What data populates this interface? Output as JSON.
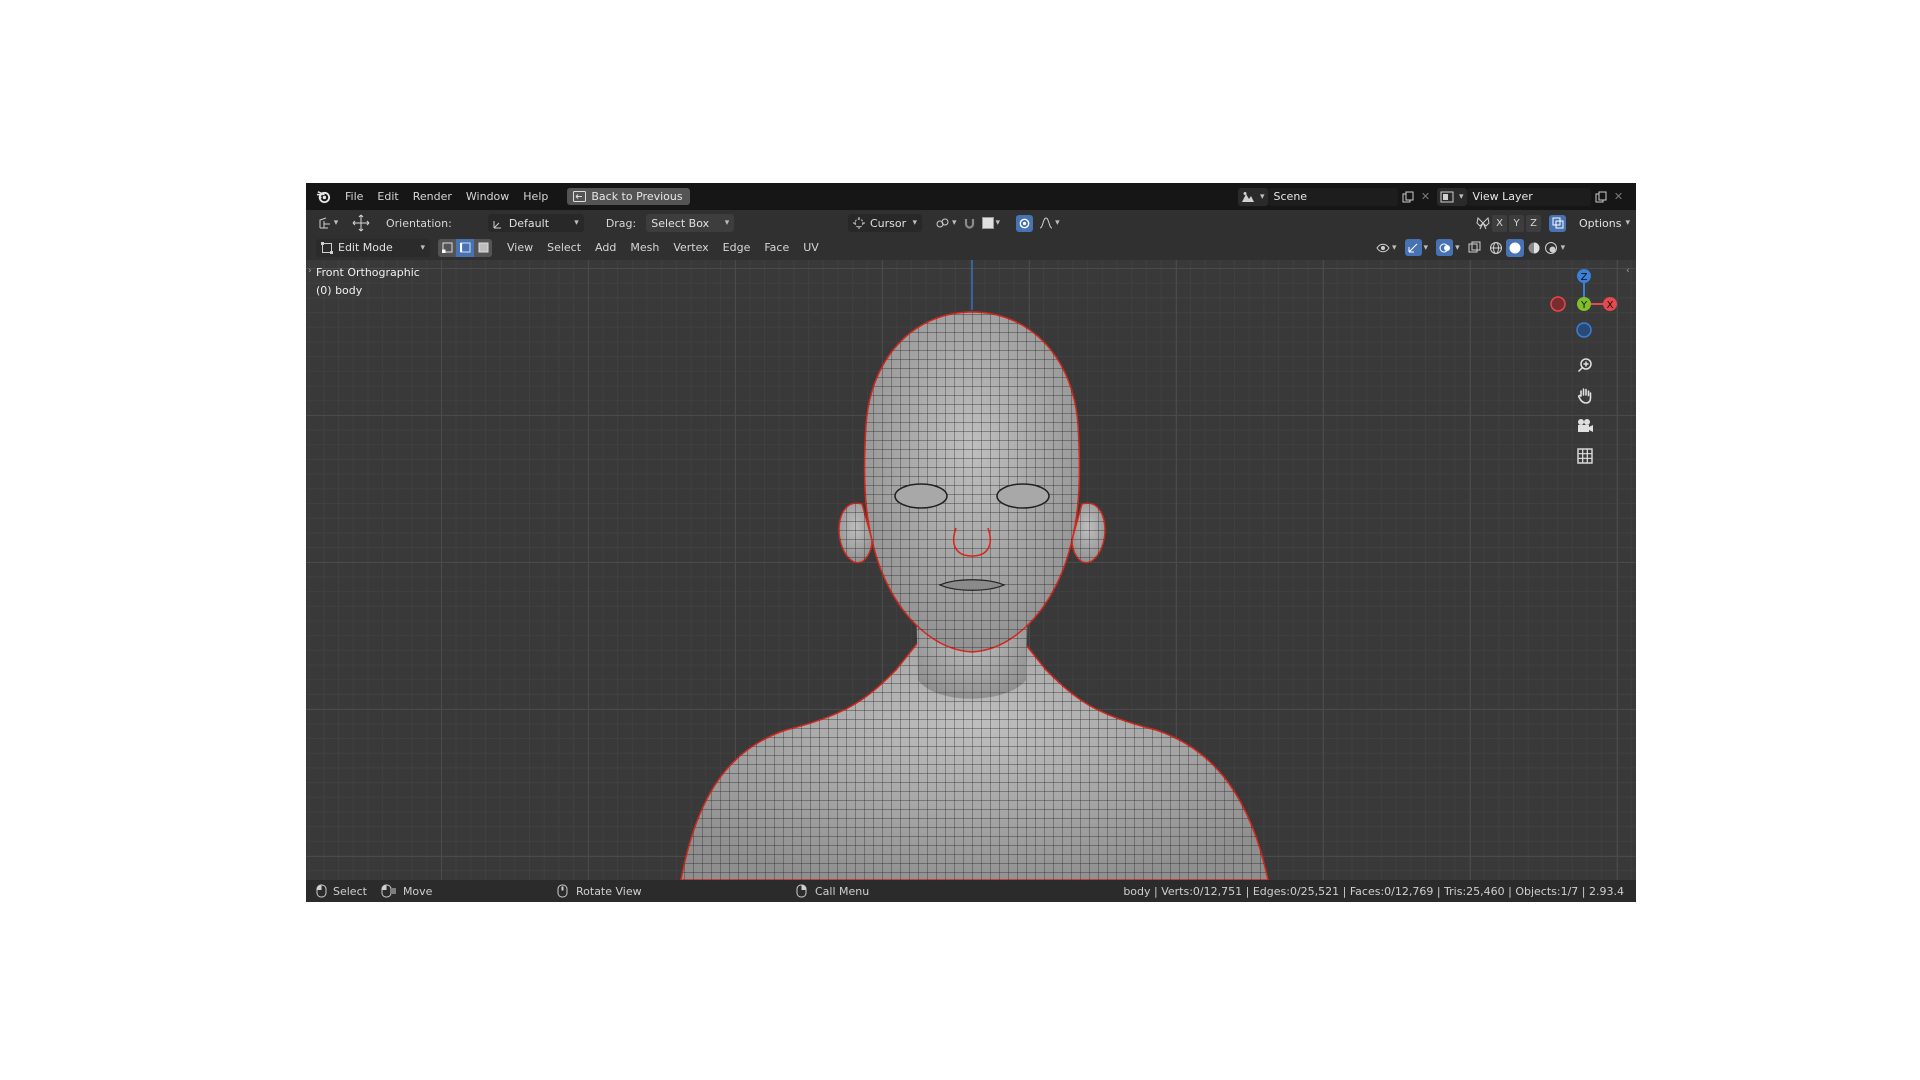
{
  "topbar": {
    "menus": [
      "File",
      "Edit",
      "Render",
      "Window",
      "Help"
    ],
    "back_button": "Back to Previous",
    "scene": "Scene",
    "view_layer": "View Layer"
  },
  "tool_header": {
    "orientation_label": "Orientation:",
    "orientation_value": "Default",
    "drag_label": "Drag:",
    "drag_value": "Select Box",
    "pivot_value": "Cursor",
    "axis_x": "X",
    "axis_y": "Y",
    "axis_z": "Z",
    "options": "Options"
  },
  "view_header": {
    "mode": "Edit Mode",
    "menus": [
      "View",
      "Select",
      "Add",
      "Mesh",
      "Vertex",
      "Edge",
      "Face",
      "UV"
    ]
  },
  "viewport": {
    "view_name": "Front Orthographic",
    "object_name": "(0) body",
    "gizmo": {
      "z": "Z",
      "y": "Y",
      "x": "X"
    },
    "colors": {
      "x_axis": "#e5484d",
      "y_axis": "#7fbf2a",
      "z_axis": "#3a7fd9",
      "selection_edge": "#d9261c"
    },
    "nav_icons": [
      "zoom-icon",
      "hand-pan-icon",
      "camera-icon",
      "grid-icon"
    ]
  },
  "statusbar": {
    "select": "Select",
    "move": "Move",
    "rotate": "Rotate View",
    "call_menu": "Call Menu",
    "stats": "body | Verts:0/12,751 | Edges:0/25,521 | Faces:0/12,769 | Tris:25,460 | Objects:1/7 | 2.93.4"
  }
}
